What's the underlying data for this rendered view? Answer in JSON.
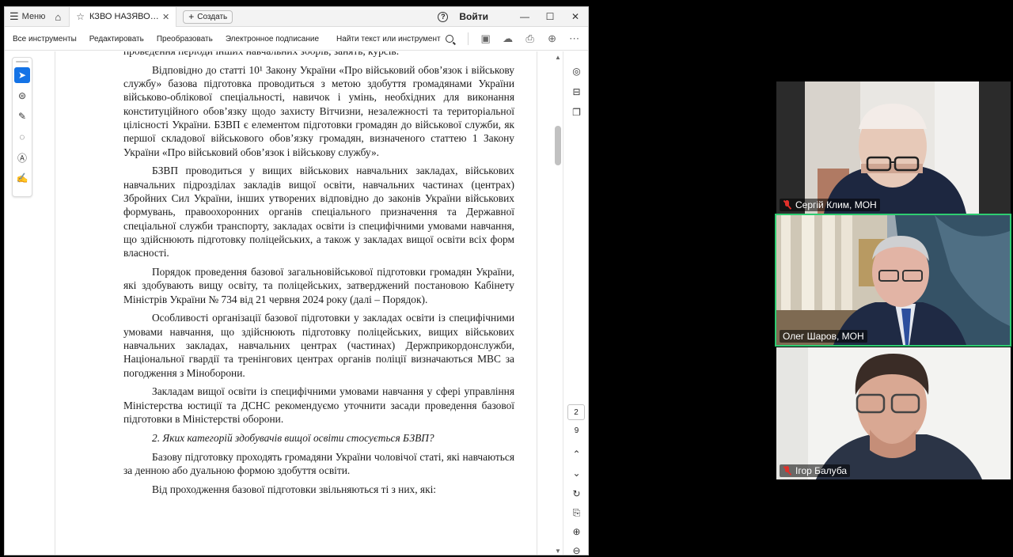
{
  "titlebar": {
    "menu_label": "Меню",
    "tab_title": "КЗВО НАЗЯВО відп...",
    "create_label": "Создать",
    "signin_label": "Войти",
    "help_glyph": "?",
    "minimize_glyph": "—",
    "maximize_glyph": "☐",
    "close_glyph": "✕"
  },
  "menubar": {
    "items": [
      "Все инструменты",
      "Редактировать",
      "Преобразовать",
      "Электронное подписание"
    ],
    "find_label": "Найти текст или инструмент"
  },
  "document": {
    "paragraphs": [
      "проведення періоди інших навчальних зборів, занять, курсів.",
      "Відповідно до статті 10¹ Закону України «Про військовий обов’язок і військову службу» базова підготовка проводиться з метою здобуття громадянами України військово-облікової спеціальності, навичок і умінь, необхідних для виконання конституційного обов’язку щодо захисту Вітчизни, незалежності та територіальної цілісності України. БЗВП є елементом підготовки громадян до військової служби, як першої складової військового обов’язку громадян, визначеного статтею 1 Закону України «Про військовий обов’язок і військову службу».",
      "БЗВП проводиться у вищих військових навчальних закладах, військових навчальних підрозділах закладів вищої освіти, навчальних частинах (центрах) Збройних Сил України, інших утворених відповідно до законів України військових формувань, правоохоронних органів спеціального призначення та Державної спеціальної служби транспорту, закладах освіти із специфічними умовами навчання, що здійснюють підготовку поліцейських, а також у закладах вищої освіти всіх форм власності.",
      "Порядок проведення базової загальновійськової підготовки громадян України, які здобувають вищу освіту, та поліцейських, затверджений постановою Кабінету Міністрів України № 734 від 21 червня 2024 року (далі – Порядок).",
      "Особливості організації базової підготовки у закладах освіти із специфічними умовами навчання, що здійснюють підготовку поліцейських, вищих військових навчальних закладах, навчальних центрах (частинах) Держприкордонслужби, Національної гвардії та тренінгових центрах органів поліції визначаються МВС за погодження з Міноборони.",
      "Закладам вищої освіти із специфічними умовами навчання у сфері управління Міністерства юстиції та ДСНС рекомендуємо уточнити засади проведення базової підготовки в Міністерстві оборони.",
      "2. Яких категорій здобувачів вищої освіти стосується БЗВП?",
      "Базову підготовку проходять громадяни України чоловічої статі, які навчаються за денною або дуальною формою здобуття освіти.",
      "Від проходження базової підготовки звільняються ті з них, які:"
    ]
  },
  "navigation": {
    "current_page": "2",
    "total_pages": "9"
  },
  "participants": [
    {
      "name": "Сергій Клим, МОН",
      "muted": true,
      "active_speaker": false
    },
    {
      "name": "Олег Шаров, МОН",
      "muted": false,
      "active_speaker": true
    },
    {
      "name": "Ігор Балуба",
      "muted": true,
      "active_speaker": false
    }
  ],
  "colors": {
    "accent_blue": "#1473e6",
    "active_speaker_border": "#2ecc71",
    "muted_red": "#e0302a"
  }
}
